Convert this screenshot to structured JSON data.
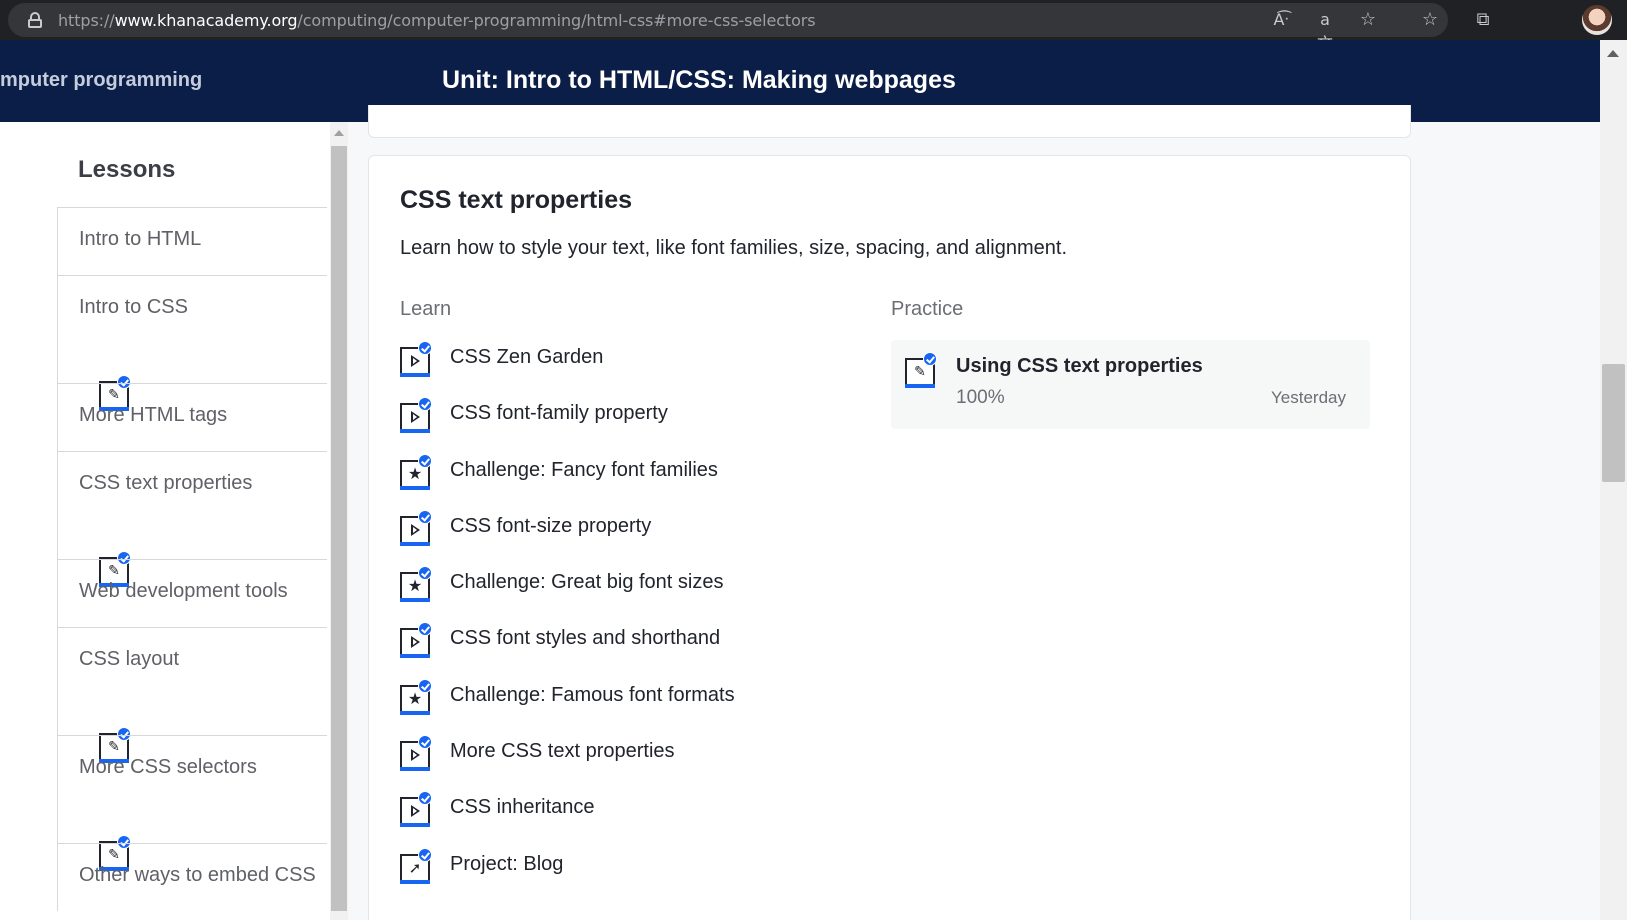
{
  "browser": {
    "url_prefix": "https://",
    "url_host": "www.khanacademy.org",
    "url_path": "/computing/computer-programming/html-css#more-css-selectors",
    "icons": [
      "read-aloud-icon",
      "translate-icon",
      "add-favorite-icon",
      "favorites-icon",
      "collections-icon",
      "profile-avatar"
    ]
  },
  "header": {
    "course": "mputer programming",
    "unit_title": "Unit: Intro to HTML/CSS: Making webpages"
  },
  "sidebar": {
    "heading": "Lessons",
    "items": [
      {
        "label": "Intro to HTML",
        "has_icon": false
      },
      {
        "label": "Intro to CSS",
        "has_icon": true
      },
      {
        "label": "More HTML tags",
        "has_icon": false
      },
      {
        "label": "CSS text properties",
        "has_icon": true
      },
      {
        "label": "Web development tools",
        "has_icon": false
      },
      {
        "label": "CSS layout",
        "has_icon": true
      },
      {
        "label": "More CSS selectors",
        "has_icon": true
      },
      {
        "label": "Other ways to embed CSS",
        "has_icon": false
      }
    ]
  },
  "lesson_card": {
    "title": "CSS text properties",
    "description": "Learn how to style your text, like font families, size, spacing, and alignment.",
    "learn_heading": "Learn",
    "practice_heading": "Practice",
    "learn_items": [
      {
        "label": "CSS Zen Garden",
        "icon": "video-icon"
      },
      {
        "label": "CSS font-family property",
        "icon": "video-icon"
      },
      {
        "label": "Challenge: Fancy font families",
        "icon": "challenge-star-icon"
      },
      {
        "label": "CSS font-size property",
        "icon": "video-icon"
      },
      {
        "label": "Challenge: Great big font sizes",
        "icon": "challenge-star-icon"
      },
      {
        "label": "CSS font styles and shorthand",
        "icon": "video-icon"
      },
      {
        "label": "Challenge: Famous font formats",
        "icon": "challenge-star-icon"
      },
      {
        "label": "More CSS text properties",
        "icon": "video-icon"
      },
      {
        "label": "CSS inheritance",
        "icon": "video-icon"
      },
      {
        "label": "Project: Blog",
        "icon": "project-rocket-icon"
      }
    ],
    "practice": {
      "title": "Using CSS text properties",
      "progress": "100%",
      "date": "Yesterday"
    }
  },
  "colors": {
    "header_bg": "#0a1e47",
    "accent_blue": "#1865f2",
    "chrome_bg": "#202124"
  }
}
